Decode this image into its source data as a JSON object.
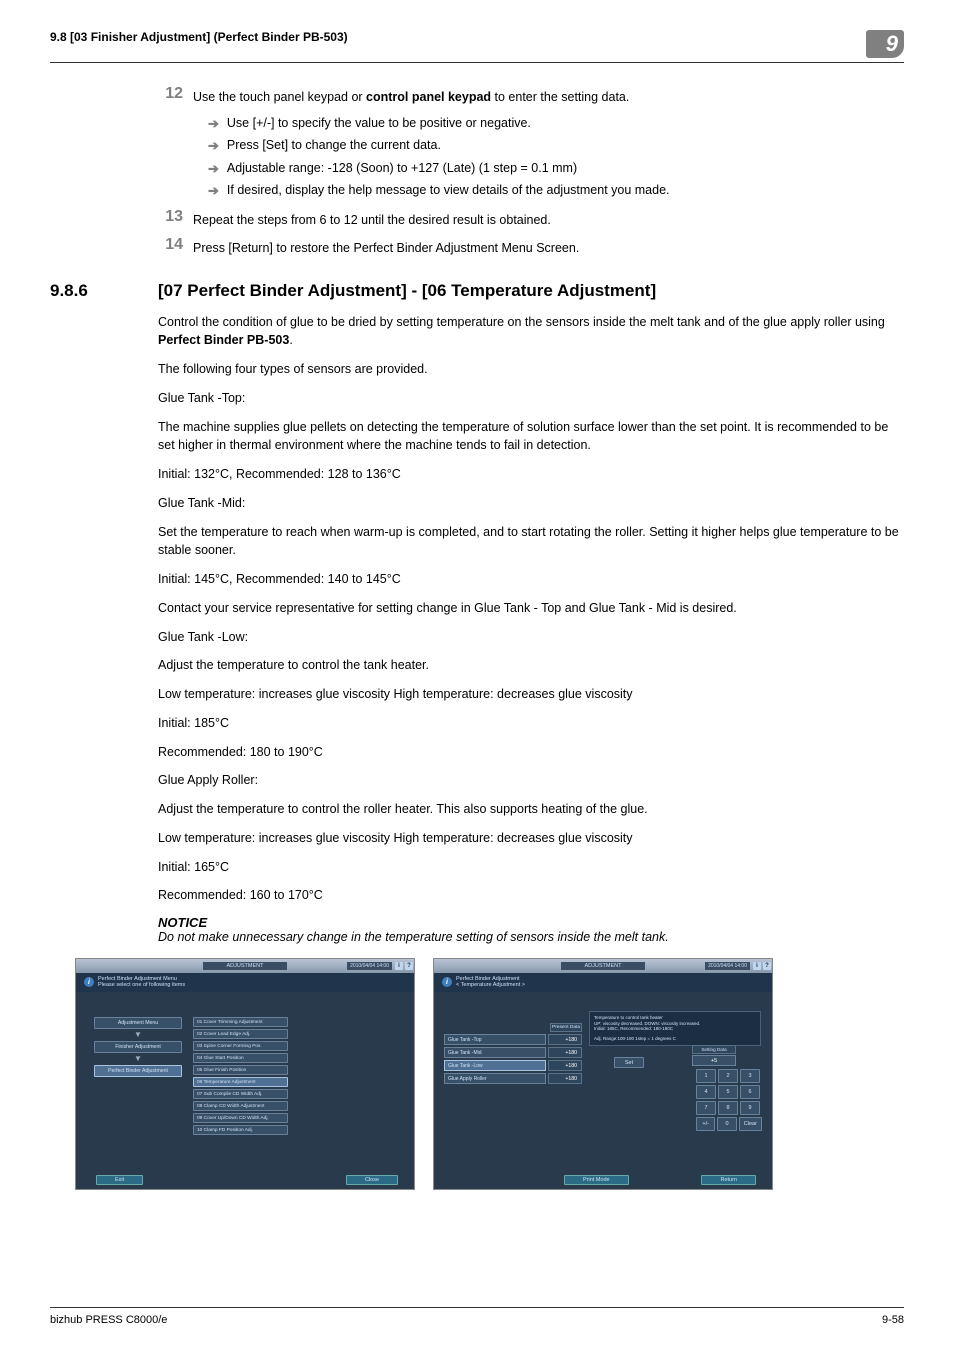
{
  "header": {
    "left": "9.8    [03 Finisher Adjustment] (Perfect Binder PB-503)",
    "chapter": "9"
  },
  "steps": {
    "s12": {
      "num": "12",
      "text_pre": "Use the touch panel keypad or ",
      "text_bold": "control panel keypad",
      "text_post": " to enter the setting data.",
      "subs": [
        "Use [+/-] to specify the value to be positive or negative.",
        "Press [Set] to change the current data.",
        "Adjustable range: -128 (Soon) to +127 (Late) (1 step = 0.1 mm)",
        "If desired, display the help message to view details of the adjustment you made."
      ]
    },
    "s13": {
      "num": "13",
      "text": "Repeat the steps from 6 to 12 until the desired result is obtained."
    },
    "s14": {
      "num": "14",
      "text": "Press [Return] to restore the Perfect Binder Adjustment Menu Screen."
    }
  },
  "section": {
    "num": "9.8.6",
    "title": "[07 Perfect Binder Adjustment] - [06 Temperature Adjustment]",
    "p1a": "Control the condition of glue to be dried by setting temperature on the sensors inside the melt tank and of the glue apply roller using ",
    "p1b": "Perfect Binder PB-503",
    "p1c": ".",
    "p2": "The following four types of sensors are provided.",
    "p3": "Glue Tank -Top:",
    "p4": "The machine supplies glue pellets on detecting the temperature of solution surface lower than the set point. It is recommended to be set higher in thermal environment where the machine tends to fail in detection.",
    "p5": "Initial: 132°C, Recommended: 128 to 136°C",
    "p6": "Glue Tank -Mid:",
    "p7": "Set the temperature to reach when warm-up is completed, and to start rotating the roller. Setting it higher helps glue temperature to be stable sooner.",
    "p8": "Initial: 145°C, Recommended: 140 to 145°C",
    "p9": "Contact your service representative for setting change in Glue Tank - Top and Glue Tank - Mid is desired.",
    "p10": "Glue Tank -Low:",
    "p11": "Adjust the temperature to control the tank heater.",
    "p12": "Low temperature: increases glue viscosity High temperature: decreases glue viscosity",
    "p13": "Initial: 185°C",
    "p14": "Recommended: 180 to 190°C",
    "p15": "Glue Apply Roller:",
    "p16": "Adjust the temperature to control the roller heater. This also supports heating of the glue.",
    "p17": "Low temperature: increases glue viscosity High temperature: decreases glue viscosity",
    "p18": "Initial: 165°C",
    "p19": "Recommended: 160 to 170°C",
    "notice_h": "NOTICE",
    "notice_b": "Do not make unnecessary change in the temperature setting of sensors inside the melt tank."
  },
  "shot1": {
    "toplabel": "ADJUSTMENT",
    "timestamp": "2010/04/04 14:00",
    "head_l1": "Perfect Binder Adjustment Menu",
    "head_l2": "Please select one of following items",
    "nav": [
      "Adjustment Menu",
      "Finisher Adjustment",
      "Perfect Binder Adjustment"
    ],
    "items": [
      "01 Cover Trimming Adjustment",
      "02 Cover Lead Edge Adj.",
      "03 Spine Corner Forming Pos.",
      "04 Glue Start Position",
      "05 Glue Finish Position",
      "06 Temperature Adjustment",
      "07 Sub Compile CD Width Adj.",
      "08 Clamp CD Width Adjustment",
      "09 Cover Up/Down CD Width Adj.",
      "10 Clamp FD Position Adj."
    ],
    "exit": "Exit",
    "close": "Close"
  },
  "shot2": {
    "toplabel": "ADJUSTMENT",
    "timestamp": "2010/04/04 14:00",
    "head_l1": "Perfect Binder Adjustment",
    "head_l2": "< Temperature Adjustment >",
    "col_present": "Present Data",
    "rows": [
      {
        "label": "Glue Tank -Top",
        "val": "+180"
      },
      {
        "label": "Glue Tank -Mid",
        "val": "+180"
      },
      {
        "label": "Glue Tank -Low",
        "val": "+180"
      },
      {
        "label": "Glue Apply Roller",
        "val": "+180"
      }
    ],
    "info_l1": "Temperature to control tank heater",
    "info_l2": "UP: viscosity decreased. DOWN: viscosity increased.",
    "info_l3": "Initial: 185C, Recommended: 180-190C",
    "info_l4": "Adj. Range:100-190 1step = 1 degrees C",
    "set": "Set",
    "setting_label": "Setting Data",
    "setting_val": "+5",
    "keys": [
      [
        "1",
        "2",
        "3"
      ],
      [
        "4",
        "5",
        "6"
      ],
      [
        "7",
        "8",
        "9"
      ],
      [
        "+/-",
        "0",
        "Clear"
      ]
    ],
    "printmode": "Print Mode",
    "ret": "Return"
  },
  "footer": {
    "left": "bizhub PRESS C8000/e",
    "right": "9-58"
  }
}
